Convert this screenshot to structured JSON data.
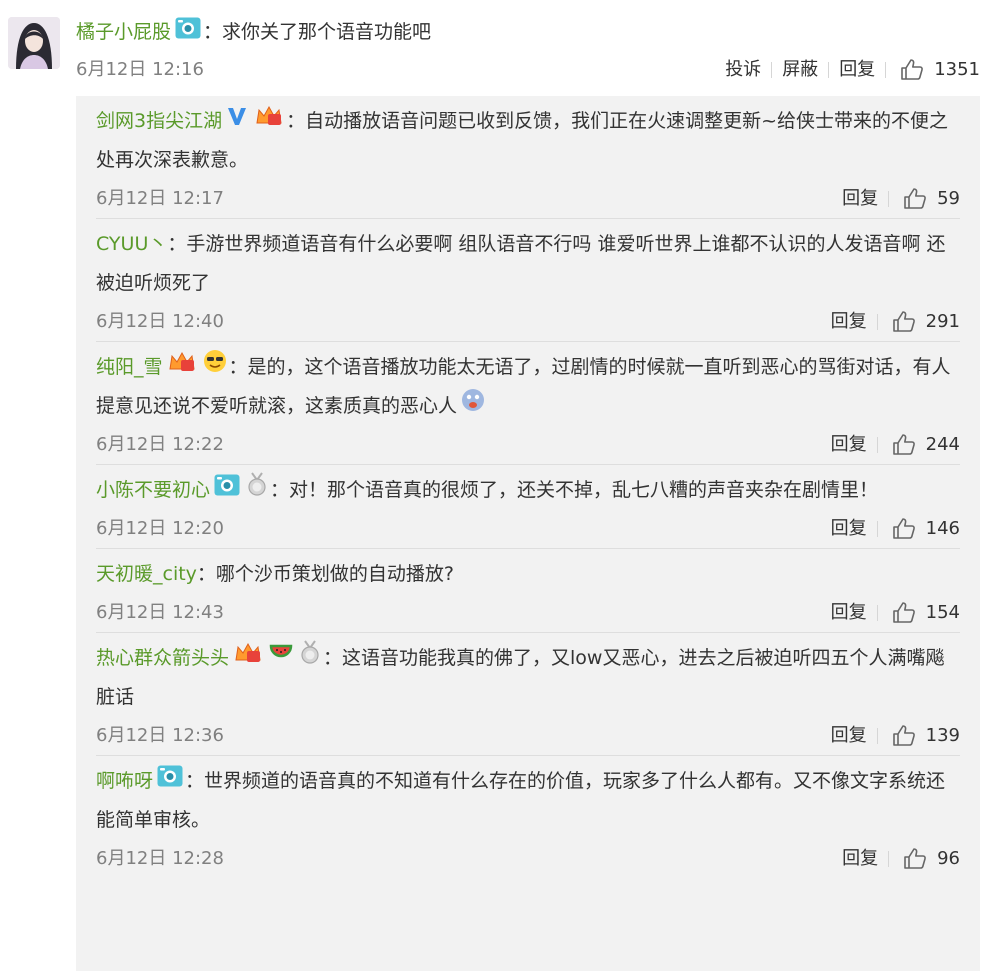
{
  "main": {
    "username": "橘子小屁股",
    "text": "：求你关了那个语音功能吧",
    "time": "6月12日 12:16",
    "actions": {
      "report": "投诉",
      "block": "屏蔽",
      "reply": "回复"
    },
    "likes": "1351"
  },
  "replies": [
    {
      "username": "剑网3指尖江湖",
      "text": "：自动播放语音问题已收到反馈，我们正在火速调整更新~给侠士带来的不便之处再次深表歉意。",
      "time": "6月12日 12:17",
      "reply": "回复",
      "likes": "59"
    },
    {
      "username": "CYUU丶",
      "text": "：手游世界频道语音有什么必要啊 组队语音不行吗 谁爱听世界上谁都不认识的人发语音啊 还被迫听烦死了",
      "time": "6月12日 12:40",
      "reply": "回复",
      "likes": "291"
    },
    {
      "username": "纯阳_雪",
      "text": "：是的，这个语音播放功能太无语了，过剧情的时候就一直听到恶心的骂街对话，有人提意见还说不爱听就滚，这素质真的恶心人",
      "time": "6月12日 12:22",
      "reply": "回复",
      "likes": "244"
    },
    {
      "username": "小陈不要初心",
      "text": "：对！那个语音真的很烦了，还关不掉，乱七八糟的声音夹杂在剧情里！",
      "time": "6月12日 12:20",
      "reply": "回复",
      "likes": "146"
    },
    {
      "username": "天初暖_city",
      "text": "：哪个沙币策划做的自动播放?",
      "time": "6月12日 12:43",
      "reply": "回复",
      "likes": "154"
    },
    {
      "username": "热心群众箭头头",
      "text": "：这语音功能我真的佛了，又low又恶心，进去之后被迫听四五个人满嘴飚脏话",
      "time": "6月12日 12:36",
      "reply": "回复",
      "likes": "139"
    },
    {
      "username": "啊咘呀",
      "text": "：世界频道的语音真的不知道有什么存在的价值，玩家多了什么人都有。又不像文字系统还能简单审核。",
      "time": "6月12日 12:28",
      "reply": "回复",
      "likes": "96"
    }
  ],
  "colors": {
    "username": "#5a9a2a",
    "time": "#808080",
    "panel": "#f2f2f2"
  }
}
